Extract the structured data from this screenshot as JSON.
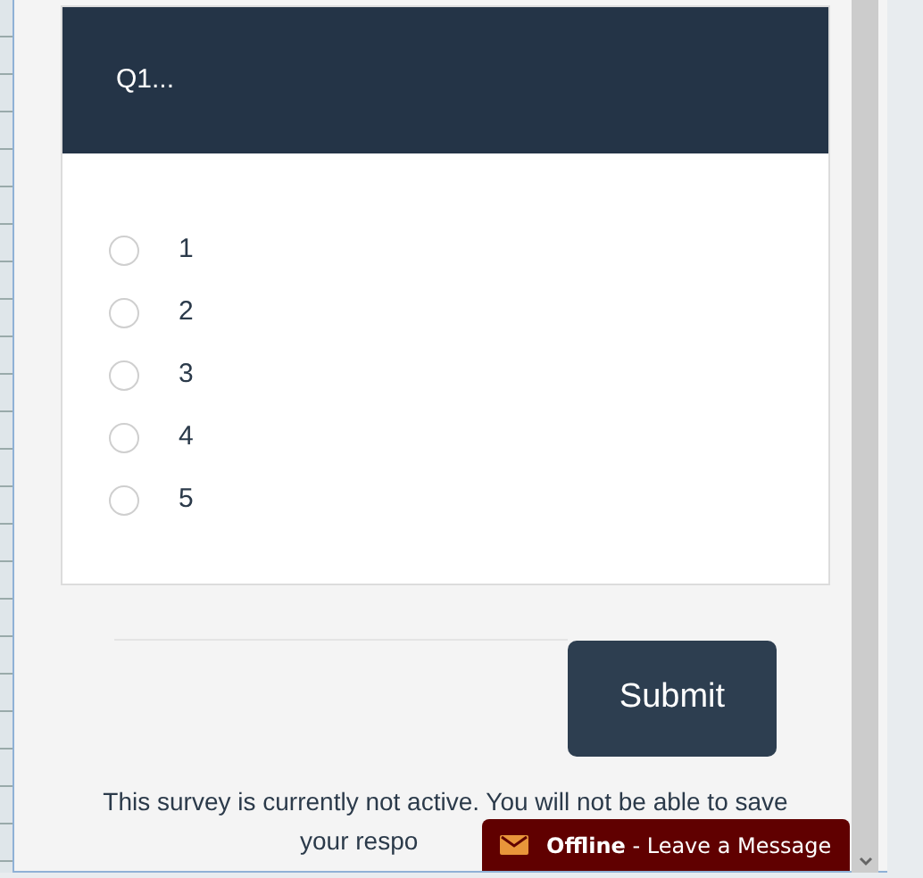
{
  "question": {
    "title": "Q1...",
    "options": [
      {
        "label": "1",
        "selected": false
      },
      {
        "label": "2",
        "selected": false
      },
      {
        "label": "3",
        "selected": false
      },
      {
        "label": "4",
        "selected": false
      },
      {
        "label": "5",
        "selected": false
      }
    ]
  },
  "submit": "Submit",
  "notice": [
    "This survey is currently not active. You will not be able to save",
    "your respo"
  ],
  "chat_widget": {
    "status": "Offline",
    "message": " - Leave a Message"
  }
}
